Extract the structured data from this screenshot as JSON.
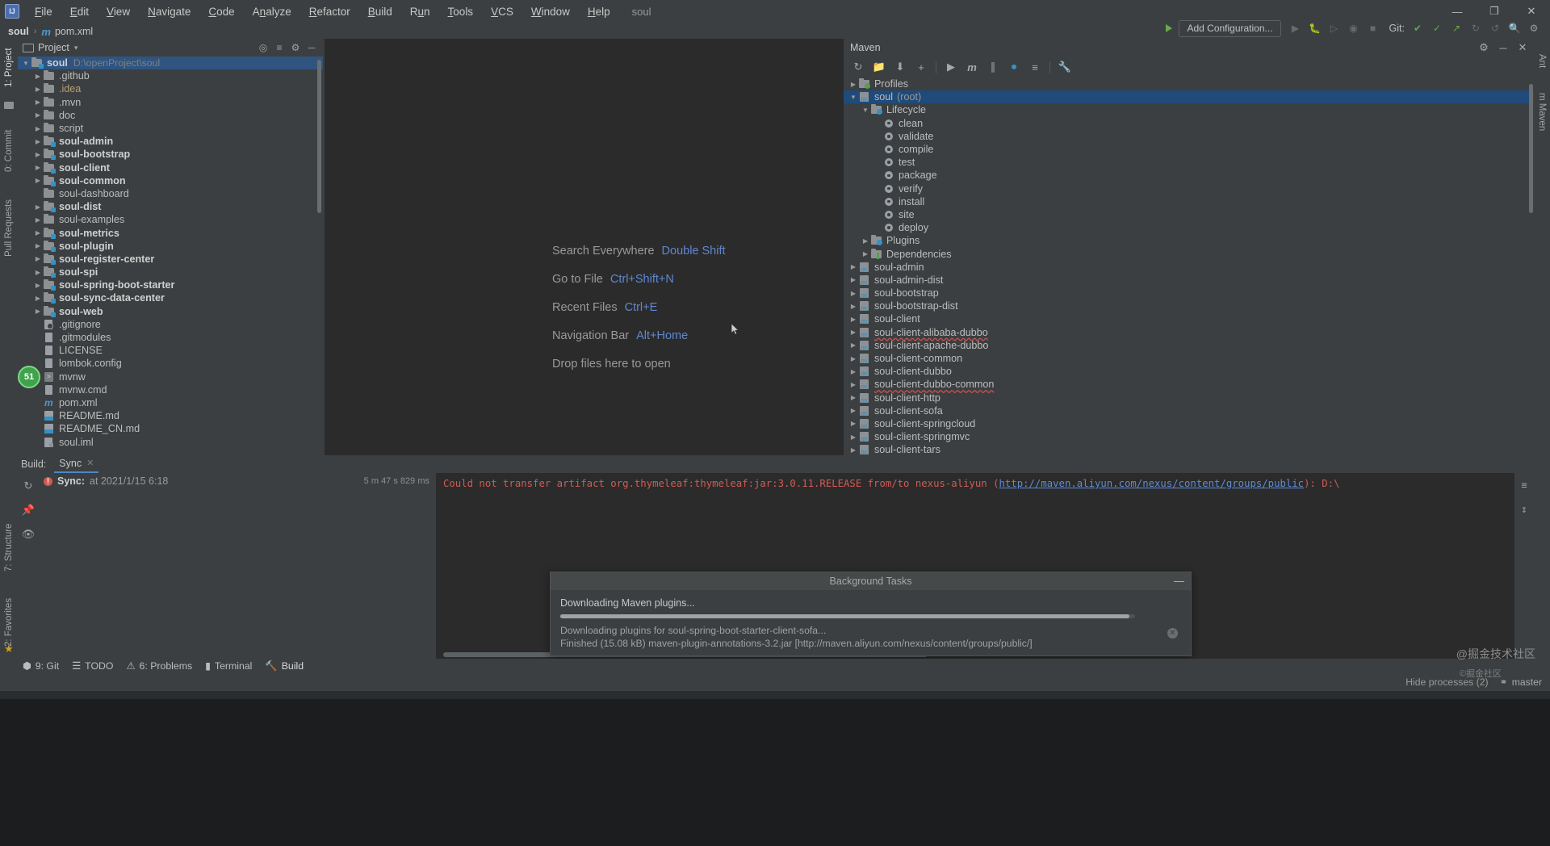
{
  "window": {
    "app_icon": "IJ",
    "project_chip": "soul",
    "controls": {
      "minimize": "—",
      "maximize": "❐",
      "close": "✕"
    }
  },
  "menu": {
    "items": [
      "File",
      "Edit",
      "View",
      "Navigate",
      "Code",
      "Analyze",
      "Refactor",
      "Build",
      "Run",
      "Tools",
      "VCS",
      "Window",
      "Help"
    ]
  },
  "navbar": {
    "project": "soul",
    "separator": "›",
    "file_icon": "m",
    "file": "pom.xml"
  },
  "toolbar": {
    "add_configuration": "Add Configuration...",
    "git_label": "Git:",
    "icons": [
      "hammer-icon",
      "run-icon",
      "debug-icon",
      "run-coverage-icon",
      "profile-icon",
      "stop-icon",
      "git-update-icon",
      "git-commit-icon",
      "git-push-icon",
      "git-history-icon",
      "git-rollback-icon",
      "search-everywhere-icon",
      "settings-icon"
    ]
  },
  "left_strip": {
    "tabs": [
      {
        "label": "1: Project",
        "icon": "project-icon",
        "selected": true
      },
      {
        "label": "0: Commit",
        "icon": "commit-icon",
        "selected": false
      },
      {
        "label": "Pull Requests",
        "icon": "pull-request-icon",
        "selected": false
      }
    ],
    "bottom_tabs": [
      {
        "label": "7: Structure",
        "icon": "structure-icon"
      },
      {
        "label": "2: Favorites",
        "icon": "favorites-icon"
      }
    ]
  },
  "right_strip": {
    "tabs": [
      {
        "label": "Ant",
        "icon": "ant-icon"
      },
      {
        "label": "m Maven",
        "icon": "maven-icon"
      }
    ]
  },
  "project_panel": {
    "title": "Project",
    "dropdown_caret": "▾",
    "header_icons": [
      "locate-icon",
      "collapse-all-icon",
      "settings-icon",
      "hide-icon"
    ],
    "tree": [
      {
        "indent": 0,
        "arrow": "down",
        "icon": "module-folder",
        "label": "soul",
        "bold": true,
        "path": "D:\\openProject\\soul",
        "selected": true
      },
      {
        "indent": 1,
        "arrow": "right",
        "icon": "folder",
        "label": ".github",
        "bold": false
      },
      {
        "indent": 1,
        "arrow": "right",
        "icon": "folder",
        "label": ".idea",
        "bold": false,
        "color": "excluded"
      },
      {
        "indent": 1,
        "arrow": "right",
        "icon": "folder",
        "label": ".mvn",
        "bold": false
      },
      {
        "indent": 1,
        "arrow": "right",
        "icon": "folder",
        "label": "doc",
        "bold": false
      },
      {
        "indent": 1,
        "arrow": "right",
        "icon": "folder",
        "label": "script",
        "bold": false
      },
      {
        "indent": 1,
        "arrow": "right",
        "icon": "module-folder",
        "label": "soul-admin",
        "bold": true
      },
      {
        "indent": 1,
        "arrow": "right",
        "icon": "module-folder",
        "label": "soul-bootstrap",
        "bold": true
      },
      {
        "indent": 1,
        "arrow": "right",
        "icon": "module-folder",
        "label": "soul-client",
        "bold": true
      },
      {
        "indent": 1,
        "arrow": "right",
        "icon": "module-folder",
        "label": "soul-common",
        "bold": true
      },
      {
        "indent": 1,
        "arrow": "none",
        "icon": "folder",
        "label": "soul-dashboard",
        "bold": false
      },
      {
        "indent": 1,
        "arrow": "right",
        "icon": "module-folder",
        "label": "soul-dist",
        "bold": true
      },
      {
        "indent": 1,
        "arrow": "right",
        "icon": "folder",
        "label": "soul-examples",
        "bold": false
      },
      {
        "indent": 1,
        "arrow": "right",
        "icon": "module-folder",
        "label": "soul-metrics",
        "bold": true
      },
      {
        "indent": 1,
        "arrow": "right",
        "icon": "module-folder",
        "label": "soul-plugin",
        "bold": true
      },
      {
        "indent": 1,
        "arrow": "right",
        "icon": "module-folder",
        "label": "soul-register-center",
        "bold": true
      },
      {
        "indent": 1,
        "arrow": "right",
        "icon": "module-folder",
        "label": "soul-spi",
        "bold": true
      },
      {
        "indent": 1,
        "arrow": "right",
        "icon": "module-folder",
        "label": "soul-spring-boot-starter",
        "bold": true
      },
      {
        "indent": 1,
        "arrow": "right",
        "icon": "module-folder",
        "label": "soul-sync-data-center",
        "bold": true
      },
      {
        "indent": 1,
        "arrow": "right",
        "icon": "module-folder",
        "label": "soul-web",
        "bold": true
      },
      {
        "indent": 1,
        "arrow": "none",
        "icon": "gitignore-file",
        "label": ".gitignore",
        "bold": false
      },
      {
        "indent": 1,
        "arrow": "none",
        "icon": "text-file",
        "label": ".gitmodules",
        "bold": false
      },
      {
        "indent": 1,
        "arrow": "none",
        "icon": "text-file",
        "label": "LICENSE",
        "bold": false
      },
      {
        "indent": 1,
        "arrow": "none",
        "icon": "text-file",
        "label": "lombok.config",
        "bold": false
      },
      {
        "indent": 1,
        "arrow": "none",
        "icon": "shell-file",
        "label": "mvnw",
        "bold": false
      },
      {
        "indent": 1,
        "arrow": "none",
        "icon": "text-file",
        "label": "mvnw.cmd",
        "bold": false
      },
      {
        "indent": 1,
        "arrow": "none",
        "icon": "maven-pom-file",
        "label": "pom.xml",
        "bold": false
      },
      {
        "indent": 1,
        "arrow": "none",
        "icon": "markdown-file",
        "label": "README.md",
        "bold": false
      },
      {
        "indent": 1,
        "arrow": "none",
        "icon": "markdown-file",
        "label": "README_CN.md",
        "bold": false
      },
      {
        "indent": 1,
        "arrow": "none",
        "icon": "iml-file",
        "label": "soul.iml",
        "bold": false
      }
    ]
  },
  "editor": {
    "tips": [
      {
        "text": "Search Everywhere",
        "key": "Double Shift"
      },
      {
        "text": "Go to File",
        "key": "Ctrl+Shift+N"
      },
      {
        "text": "Recent Files",
        "key": "Ctrl+E"
      },
      {
        "text": "Navigation Bar",
        "key": "Alt+Home"
      },
      {
        "text": "Drop files here to open",
        "key": ""
      }
    ]
  },
  "maven_panel": {
    "title": "Maven",
    "toolbar_icons": [
      "reimport-icon",
      "generate-sources-icon",
      "download-sources-icon",
      "add-maven-project-icon",
      "run-icon",
      "execute-maven-goal-icon",
      "toggle-offline-icon",
      "toggle-skip-tests-icon",
      "collapse-all-icon",
      "settings-icon"
    ],
    "tree": [
      {
        "indent": 0,
        "arrow": "right",
        "icon": "profiles-folder",
        "label": "Profiles"
      },
      {
        "indent": 0,
        "arrow": "down",
        "icon": "maven-project",
        "label": "soul",
        "suffix": "(root)",
        "selected": true
      },
      {
        "indent": 1,
        "arrow": "down",
        "icon": "lifecycle-folder",
        "label": "Lifecycle"
      },
      {
        "indent": 2,
        "arrow": "none",
        "icon": "goal-gear",
        "label": "clean"
      },
      {
        "indent": 2,
        "arrow": "none",
        "icon": "goal-gear",
        "label": "validate"
      },
      {
        "indent": 2,
        "arrow": "none",
        "icon": "goal-gear",
        "label": "compile"
      },
      {
        "indent": 2,
        "arrow": "none",
        "icon": "goal-gear",
        "label": "test"
      },
      {
        "indent": 2,
        "arrow": "none",
        "icon": "goal-gear",
        "label": "package"
      },
      {
        "indent": 2,
        "arrow": "none",
        "icon": "goal-gear",
        "label": "verify"
      },
      {
        "indent": 2,
        "arrow": "none",
        "icon": "goal-gear",
        "label": "install"
      },
      {
        "indent": 2,
        "arrow": "none",
        "icon": "goal-gear",
        "label": "site"
      },
      {
        "indent": 2,
        "arrow": "none",
        "icon": "goal-gear",
        "label": "deploy"
      },
      {
        "indent": 1,
        "arrow": "right",
        "icon": "plugins-folder",
        "label": "Plugins"
      },
      {
        "indent": 1,
        "arrow": "right",
        "icon": "dependencies-folder",
        "label": "Dependencies"
      },
      {
        "indent": 0,
        "arrow": "right",
        "icon": "maven-project",
        "label": "soul-admin"
      },
      {
        "indent": 0,
        "arrow": "right",
        "icon": "maven-project",
        "label": "soul-admin-dist"
      },
      {
        "indent": 0,
        "arrow": "right",
        "icon": "maven-project",
        "label": "soul-bootstrap"
      },
      {
        "indent": 0,
        "arrow": "right",
        "icon": "maven-project",
        "label": "soul-bootstrap-dist"
      },
      {
        "indent": 0,
        "arrow": "right",
        "icon": "maven-project",
        "label": "soul-client"
      },
      {
        "indent": 0,
        "arrow": "right",
        "icon": "maven-project",
        "label": "soul-client-alibaba-dubbo",
        "spellcheck_error": true
      },
      {
        "indent": 0,
        "arrow": "right",
        "icon": "maven-project",
        "label": "soul-client-apache-dubbo"
      },
      {
        "indent": 0,
        "arrow": "right",
        "icon": "maven-project",
        "label": "soul-client-common"
      },
      {
        "indent": 0,
        "arrow": "right",
        "icon": "maven-project",
        "label": "soul-client-dubbo"
      },
      {
        "indent": 0,
        "arrow": "right",
        "icon": "maven-project",
        "label": "soul-client-dubbo-common",
        "spellcheck_error": true
      },
      {
        "indent": 0,
        "arrow": "right",
        "icon": "maven-project",
        "label": "soul-client-http"
      },
      {
        "indent": 0,
        "arrow": "right",
        "icon": "maven-project",
        "label": "soul-client-sofa"
      },
      {
        "indent": 0,
        "arrow": "right",
        "icon": "maven-project",
        "label": "soul-client-springcloud"
      },
      {
        "indent": 0,
        "arrow": "right",
        "icon": "maven-project",
        "label": "soul-client-springmvc"
      },
      {
        "indent": 0,
        "arrow": "right",
        "icon": "maven-project",
        "label": "soul-client-tars"
      }
    ]
  },
  "build_window": {
    "label": "Build:",
    "tab": "Sync",
    "tab_close": "✕",
    "sync_title": "Sync:",
    "sync_time": "at 2021/1/15 6:18",
    "duration": "5 m 47 s 829 ms",
    "console_text_pre": "Could not transfer artifact org.thymeleaf:thymeleaf:jar:3.0.11.RELEASE from/to nexus-aliyun (",
    "console_link": "http://maven.aliyun.com/nexus/content/groups/public",
    "console_text_post": "): D:\\",
    "side_icons": [
      "rerun-icon",
      "pin-icon",
      "eye-icon"
    ],
    "right_icons": [
      "soft-wrap-icon",
      "scroll-to-end-icon"
    ]
  },
  "background_tasks": {
    "title": "Background Tasks",
    "minimize": "—",
    "line1": "Downloading Maven plugins...",
    "cancel": "✕",
    "line2": "Downloading plugins for soul-spring-boot-starter-client-sofa...",
    "line3": "Finished (15.08 kB) maven-plugin-annotations-3.2.jar [http://maven.aliyun.com/nexus/content/groups/public/]",
    "progress_percent": 99
  },
  "bottom_tabs": [
    {
      "label": "9: Git",
      "icon": "git-icon",
      "num": "9"
    },
    {
      "label": "TODO",
      "icon": "todo-icon",
      "num": ""
    },
    {
      "label": "6: Problems",
      "icon": "problems-icon",
      "num": "6"
    },
    {
      "label": "Terminal",
      "icon": "terminal-icon",
      "num": ""
    },
    {
      "label": "Build",
      "icon": "build-hammer-icon",
      "num": "",
      "selected": true
    }
  ],
  "status_bar": {
    "hide_processes": "Hide processes (2)",
    "branch": "master",
    "branch_icon": "git-branch-icon"
  },
  "watermark": {
    "text": "@掘金技术社区",
    "sub": "©掘金社区"
  },
  "colors": {
    "accent_blue": "#3592c4",
    "selection_blue": "#2f5480",
    "maven_selection": "#1f4a7a",
    "error_red": "#cf5b56",
    "link_blue": "#5b8cd6",
    "panel_bg": "#3c3f41",
    "editor_bg": "#2b2b2b"
  }
}
